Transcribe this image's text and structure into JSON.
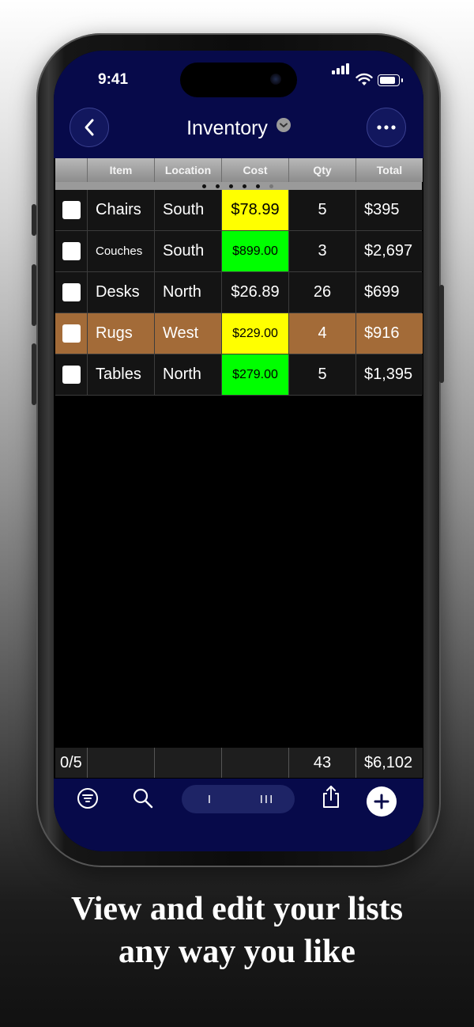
{
  "status": {
    "time": "9:41"
  },
  "nav": {
    "title": "Inventory"
  },
  "table": {
    "columns": [
      "Item",
      "Location",
      "Cost",
      "Qty",
      "Total"
    ],
    "rows": [
      {
        "item": "Chairs",
        "location": "South",
        "cost": "$78.99",
        "qty": "5",
        "total": "$395",
        "cost_color": "#ffff00"
      },
      {
        "item": "Couches",
        "location": "South",
        "cost": "$899.00",
        "qty": "3",
        "total": "$2,697",
        "cost_color": "#00ff00"
      },
      {
        "item": "Desks",
        "location": "North",
        "cost": "$26.89",
        "qty": "26",
        "total": "$699",
        "cost_color": "#141414"
      },
      {
        "item": "Rugs",
        "location": "West",
        "cost": "$229.00",
        "qty": "4",
        "total": "$916",
        "cost_color": "#ffff00",
        "row_color": "#a36b38"
      },
      {
        "item": "Tables",
        "location": "North",
        "cost": "$279.00",
        "qty": "5",
        "total": "$1,395",
        "cost_color": "#00ff00"
      }
    ],
    "footer": {
      "count": "0/5",
      "qty_sum": "43",
      "total_sum": "$6,102"
    }
  },
  "toolbar": {
    "seg_left": "I",
    "seg_right": "III"
  },
  "caption": {
    "line1": "View and edit your lists",
    "line2": "any way you like"
  },
  "colors": {
    "nav_bg": "#070a4a",
    "highlight_row": "#a36b38",
    "yellow": "#ffff00",
    "green": "#00ff00"
  },
  "icons": [
    "back-chevron-icon",
    "more-ellipsis-icon",
    "filter-icon",
    "search-icon",
    "share-icon",
    "add-icon"
  ]
}
